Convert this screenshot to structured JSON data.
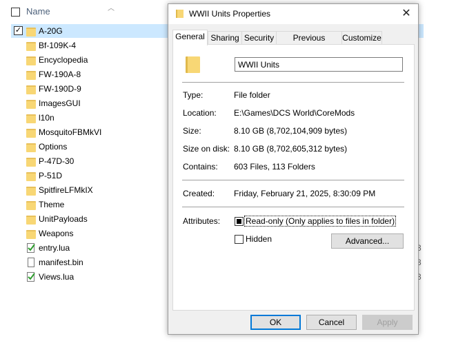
{
  "explorer": {
    "column_name": "Name",
    "items": [
      {
        "label": "A-20G",
        "type": "folder",
        "selected": true
      },
      {
        "label": "Bf-109K-4",
        "type": "folder"
      },
      {
        "label": "Encyclopedia",
        "type": "folder"
      },
      {
        "label": "FW-190A-8",
        "type": "folder"
      },
      {
        "label": "FW-190D-9",
        "type": "folder"
      },
      {
        "label": "ImagesGUI",
        "type": "folder"
      },
      {
        "label": "l10n",
        "type": "folder"
      },
      {
        "label": "MosquitoFBMkVI",
        "type": "folder"
      },
      {
        "label": "Options",
        "type": "folder"
      },
      {
        "label": "P-47D-30",
        "type": "folder"
      },
      {
        "label": "P-51D",
        "type": "folder"
      },
      {
        "label": "SpitfireLFMkIX",
        "type": "folder"
      },
      {
        "label": "Theme",
        "type": "folder"
      },
      {
        "label": "UnitPayloads",
        "type": "folder"
      },
      {
        "label": "Weapons",
        "type": "folder"
      },
      {
        "label": "entry.lua",
        "type": "lua"
      },
      {
        "label": "manifest.bin",
        "type": "file"
      },
      {
        "label": "Views.lua",
        "type": "lua"
      }
    ],
    "truncated_size_suffix": "3"
  },
  "dialog": {
    "title": "WWII Units Properties",
    "close_glyph": "✕",
    "tabs": [
      "General",
      "Sharing",
      "Security",
      "Previous Versions",
      "Customize"
    ],
    "name_value": "WWII Units",
    "props": {
      "type_label": "Type:",
      "type_value": "File folder",
      "location_label": "Location:",
      "location_value": "E:\\Games\\DCS World\\CoreMods",
      "size_label": "Size:",
      "size_value": "8.10 GB (8,702,104,909 bytes)",
      "size_disk_label": "Size on disk:",
      "size_disk_value": "8.10 GB (8,702,605,312 bytes)",
      "contains_label": "Contains:",
      "contains_value": "603 Files, 113 Folders",
      "created_label": "Created:",
      "created_value": "Friday, February 21, 2025, 8:30:09 PM",
      "attributes_label": "Attributes:",
      "readonly_label": "Read-only (Only applies to files in folder)",
      "hidden_label": "Hidden",
      "advanced_label": "Advanced..."
    },
    "buttons": {
      "ok": "OK",
      "cancel": "Cancel",
      "apply": "Apply"
    }
  }
}
